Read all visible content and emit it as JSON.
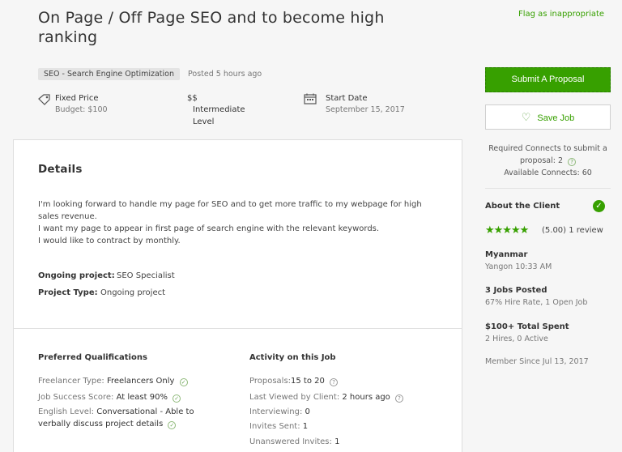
{
  "job": {
    "title_line1": "On Page / Off Page SEO and to become high",
    "title_line2": "ranking",
    "flag_label": "Flag as inappropriate",
    "category": "SEO - Search Engine Optimization",
    "posted": "Posted 5 hours ago",
    "price_type": "Fixed Price",
    "budget": "Budget: $100",
    "level_symbol": "$$",
    "level_line1": "Intermediate",
    "level_line2": "Level",
    "start_label": "Start Date",
    "start_value": "September 15, 2017"
  },
  "details": {
    "heading": "Details",
    "lines": [
      "I'm looking forward to handle my page for SEO and to get more traffic to my webpage for high",
      "sales revenue.",
      "I want my page to appear in first page of search engine with the relevant keywords.",
      "I would like to contract by monthly."
    ],
    "ongoing_label": "Ongoing project:",
    "ongoing_value": "SEO Specialist",
    "type_label": "Project Type:",
    "type_value": "Ongoing project"
  },
  "qualifications": {
    "heading": "Preferred Qualifications",
    "freelancer_label": "Freelancer Type:",
    "freelancer_value": "Freelancers Only",
    "jss_label": "Job Success Score:",
    "jss_value": "At least 90%",
    "english_label": "English Level:",
    "english_value_line1": "Conversational - Able to",
    "english_value_line2": "verbally discuss project details"
  },
  "activity": {
    "heading": "Activity on this Job",
    "proposals_label": "Proposals:",
    "proposals_value": "15 to 20",
    "viewed_label": "Last Viewed by Client:",
    "viewed_value": "2 hours ago",
    "interviewing_label": "Interviewing:",
    "interviewing_value": "0",
    "invites_label": "Invites Sent:",
    "invites_value": "1",
    "unanswered_label": "Unanswered Invites:",
    "unanswered_value": "1"
  },
  "sidebar": {
    "submit_label": "Submit A Proposal",
    "save_label": "Save Job",
    "connects_line1": "Required Connects to submit a",
    "connects_line2": "proposal: 2",
    "connects_line3": "Available Connects: 60",
    "about_label": "About the Client",
    "stars": "★★★★★",
    "rating_value": 5.0,
    "rating_text": "(5.00) 1 review",
    "country": "Myanmar",
    "city_time": "Yangon 10:33 AM",
    "jobs_posted": "3 Jobs Posted",
    "hire_rate": "67% Hire Rate, 1 Open Job",
    "total_spent": "$100+ Total Spent",
    "hires_active": "2 Hires, 0 Active",
    "member_since": "Member Since Jul 13, 2017"
  },
  "icons": {
    "price": "tag-icon",
    "start": "calendar-icon",
    "verified": "check-circle-icon",
    "save": "heart-icon",
    "help": "question-circle-icon"
  },
  "colors": {
    "accent": "#37a000",
    "background": "#f6f6f6",
    "card": "#ffffff"
  }
}
